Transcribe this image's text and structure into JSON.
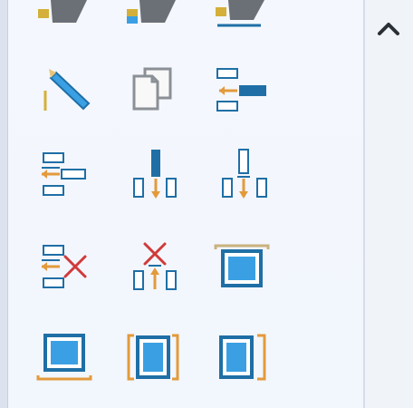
{
  "toolbar": {
    "tools_top_row_partial": [
      {
        "icon": "tag-pen-icon"
      },
      {
        "icon": "tag-pen-blue-icon"
      },
      {
        "icon": "tag-pen-line-icon"
      }
    ],
    "tools": [
      {
        "icon": "edit-pencil-icon"
      },
      {
        "icon": "copy-pages-icon"
      },
      {
        "icon": "align-left-icon"
      },
      {
        "icon": "align-center-horizontal-icon"
      },
      {
        "icon": "align-top-icon"
      },
      {
        "icon": "align-middle-vertical-icon"
      },
      {
        "icon": "delete-align-horizontal-icon"
      },
      {
        "icon": "delete-align-vertical-icon"
      },
      {
        "icon": "frame-top-icon"
      },
      {
        "icon": "frame-bottom-icon"
      },
      {
        "icon": "frame-left-icon"
      },
      {
        "icon": "frame-right-icon"
      }
    ],
    "scroll": {
      "icon": "chevron-up-icon"
    }
  },
  "colors": {
    "accent_blue": "#1f6fa6",
    "light_blue": "#3aa0e3",
    "orange": "#e39a3b",
    "gold": "#d4b03a",
    "gray": "#8b8f96",
    "red_x": "#d03a3a"
  }
}
